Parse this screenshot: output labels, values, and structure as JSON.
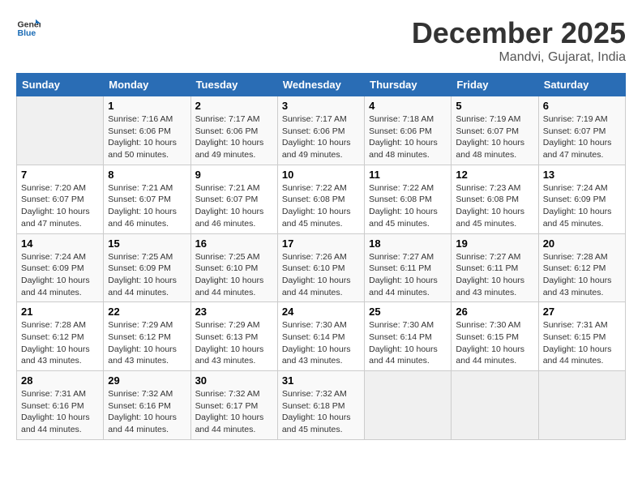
{
  "logo": {
    "line1": "General",
    "line2": "Blue"
  },
  "title": "December 2025",
  "location": "Mandvi, Gujarat, India",
  "days_of_week": [
    "Sunday",
    "Monday",
    "Tuesday",
    "Wednesday",
    "Thursday",
    "Friday",
    "Saturday"
  ],
  "weeks": [
    [
      {
        "day": "",
        "info": ""
      },
      {
        "day": "1",
        "info": "Sunrise: 7:16 AM\nSunset: 6:06 PM\nDaylight: 10 hours and 50 minutes."
      },
      {
        "day": "2",
        "info": "Sunrise: 7:17 AM\nSunset: 6:06 PM\nDaylight: 10 hours and 49 minutes."
      },
      {
        "day": "3",
        "info": "Sunrise: 7:17 AM\nSunset: 6:06 PM\nDaylight: 10 hours and 49 minutes."
      },
      {
        "day": "4",
        "info": "Sunrise: 7:18 AM\nSunset: 6:06 PM\nDaylight: 10 hours and 48 minutes."
      },
      {
        "day": "5",
        "info": "Sunrise: 7:19 AM\nSunset: 6:07 PM\nDaylight: 10 hours and 48 minutes."
      },
      {
        "day": "6",
        "info": "Sunrise: 7:19 AM\nSunset: 6:07 PM\nDaylight: 10 hours and 47 minutes."
      }
    ],
    [
      {
        "day": "7",
        "info": "Sunrise: 7:20 AM\nSunset: 6:07 PM\nDaylight: 10 hours and 47 minutes."
      },
      {
        "day": "8",
        "info": "Sunrise: 7:21 AM\nSunset: 6:07 PM\nDaylight: 10 hours and 46 minutes."
      },
      {
        "day": "9",
        "info": "Sunrise: 7:21 AM\nSunset: 6:07 PM\nDaylight: 10 hours and 46 minutes."
      },
      {
        "day": "10",
        "info": "Sunrise: 7:22 AM\nSunset: 6:08 PM\nDaylight: 10 hours and 45 minutes."
      },
      {
        "day": "11",
        "info": "Sunrise: 7:22 AM\nSunset: 6:08 PM\nDaylight: 10 hours and 45 minutes."
      },
      {
        "day": "12",
        "info": "Sunrise: 7:23 AM\nSunset: 6:08 PM\nDaylight: 10 hours and 45 minutes."
      },
      {
        "day": "13",
        "info": "Sunrise: 7:24 AM\nSunset: 6:09 PM\nDaylight: 10 hours and 45 minutes."
      }
    ],
    [
      {
        "day": "14",
        "info": "Sunrise: 7:24 AM\nSunset: 6:09 PM\nDaylight: 10 hours and 44 minutes."
      },
      {
        "day": "15",
        "info": "Sunrise: 7:25 AM\nSunset: 6:09 PM\nDaylight: 10 hours and 44 minutes."
      },
      {
        "day": "16",
        "info": "Sunrise: 7:25 AM\nSunset: 6:10 PM\nDaylight: 10 hours and 44 minutes."
      },
      {
        "day": "17",
        "info": "Sunrise: 7:26 AM\nSunset: 6:10 PM\nDaylight: 10 hours and 44 minutes."
      },
      {
        "day": "18",
        "info": "Sunrise: 7:27 AM\nSunset: 6:11 PM\nDaylight: 10 hours and 44 minutes."
      },
      {
        "day": "19",
        "info": "Sunrise: 7:27 AM\nSunset: 6:11 PM\nDaylight: 10 hours and 43 minutes."
      },
      {
        "day": "20",
        "info": "Sunrise: 7:28 AM\nSunset: 6:12 PM\nDaylight: 10 hours and 43 minutes."
      }
    ],
    [
      {
        "day": "21",
        "info": "Sunrise: 7:28 AM\nSunset: 6:12 PM\nDaylight: 10 hours and 43 minutes."
      },
      {
        "day": "22",
        "info": "Sunrise: 7:29 AM\nSunset: 6:12 PM\nDaylight: 10 hours and 43 minutes."
      },
      {
        "day": "23",
        "info": "Sunrise: 7:29 AM\nSunset: 6:13 PM\nDaylight: 10 hours and 43 minutes."
      },
      {
        "day": "24",
        "info": "Sunrise: 7:30 AM\nSunset: 6:14 PM\nDaylight: 10 hours and 43 minutes."
      },
      {
        "day": "25",
        "info": "Sunrise: 7:30 AM\nSunset: 6:14 PM\nDaylight: 10 hours and 44 minutes."
      },
      {
        "day": "26",
        "info": "Sunrise: 7:30 AM\nSunset: 6:15 PM\nDaylight: 10 hours and 44 minutes."
      },
      {
        "day": "27",
        "info": "Sunrise: 7:31 AM\nSunset: 6:15 PM\nDaylight: 10 hours and 44 minutes."
      }
    ],
    [
      {
        "day": "28",
        "info": "Sunrise: 7:31 AM\nSunset: 6:16 PM\nDaylight: 10 hours and 44 minutes."
      },
      {
        "day": "29",
        "info": "Sunrise: 7:32 AM\nSunset: 6:16 PM\nDaylight: 10 hours and 44 minutes."
      },
      {
        "day": "30",
        "info": "Sunrise: 7:32 AM\nSunset: 6:17 PM\nDaylight: 10 hours and 44 minutes."
      },
      {
        "day": "31",
        "info": "Sunrise: 7:32 AM\nSunset: 6:18 PM\nDaylight: 10 hours and 45 minutes."
      },
      {
        "day": "",
        "info": ""
      },
      {
        "day": "",
        "info": ""
      },
      {
        "day": "",
        "info": ""
      }
    ]
  ]
}
